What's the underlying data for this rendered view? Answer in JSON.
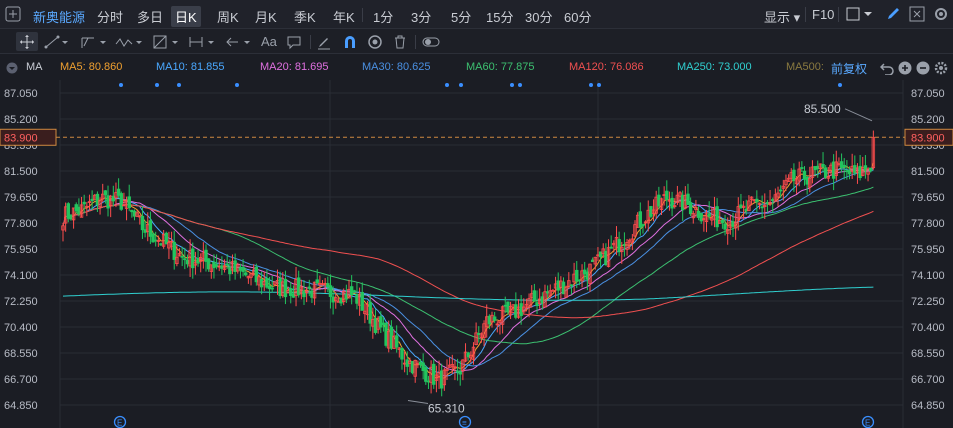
{
  "stock": {
    "name": "新奥能源"
  },
  "timeframes": [
    {
      "label": "分时",
      "active": false
    },
    {
      "label": "多日",
      "active": false
    },
    {
      "label": "日K",
      "active": true
    },
    {
      "label": "周K",
      "active": false
    },
    {
      "label": "月K",
      "active": false
    },
    {
      "label": "季K",
      "active": false
    },
    {
      "label": "年K",
      "active": false
    },
    {
      "label": "1分",
      "active": false
    },
    {
      "label": "3分",
      "active": false
    },
    {
      "label": "5分",
      "active": false
    },
    {
      "label": "15分",
      "active": false
    },
    {
      "label": "30分",
      "active": false
    },
    {
      "label": "60分",
      "active": false
    }
  ],
  "top_right": {
    "display_label": "显示",
    "f10_label": "F10"
  },
  "toolbar": {
    "font_label": "Aa"
  },
  "ma_bar": {
    "label": "MA",
    "items": [
      {
        "text": "MA5: 80.860",
        "color": "#f0a030"
      },
      {
        "text": "MA10: 81.855",
        "color": "#4aa8ff"
      },
      {
        "text": "MA20: 81.695",
        "color": "#e070e0"
      },
      {
        "text": "MA30: 80.625",
        "color": "#4a90e2"
      },
      {
        "text": "MA60: 77.875",
        "color": "#3cc070"
      },
      {
        "text": "MA120: 76.086",
        "color": "#f05050"
      },
      {
        "text": "MA250: 73.000",
        "color": "#30d0d0"
      },
      {
        "text": "MA500:",
        "color": "#8a7a40"
      }
    ],
    "adjust_label": "前复权"
  },
  "chart_data": {
    "type": "candlestick",
    "y_ticks": [
      "87.050",
      "85.200",
      "83.350",
      "81.500",
      "79.650",
      "77.800",
      "75.950",
      "74.100",
      "72.250",
      "70.400",
      "68.550",
      "66.700",
      "64.850"
    ],
    "y_range": [
      64.85,
      87.05
    ],
    "current_price": "83.900",
    "high_label": "85.500",
    "low_label": "65.310",
    "colors": {
      "up": "#ff4d4d",
      "down": "#22c55e",
      "ma5": "#f0a030",
      "ma10": "#4aa8ff",
      "ma20": "#e070e0",
      "ma30": "#4a90e2",
      "ma60": "#3cc070",
      "ma120": "#f05050",
      "ma250": "#30d0d0"
    }
  }
}
